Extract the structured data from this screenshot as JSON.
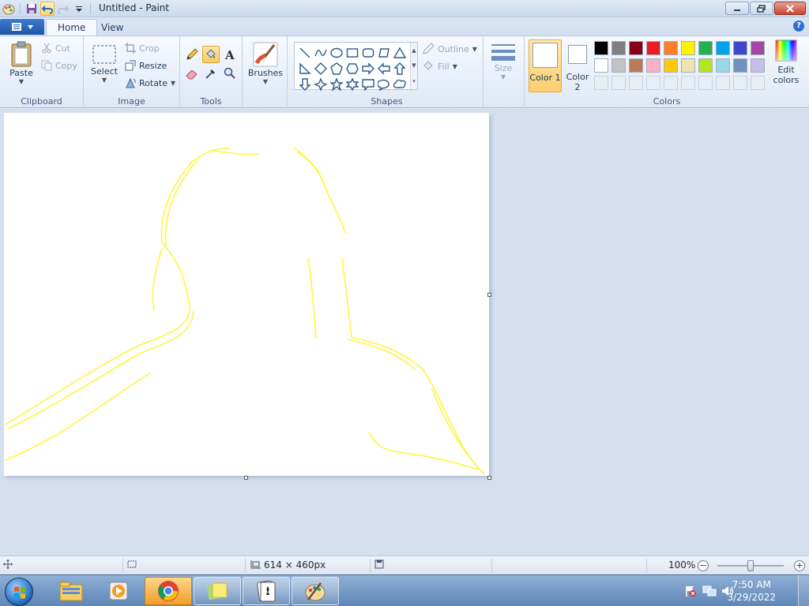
{
  "window": {
    "title": "Untitled - Paint"
  },
  "tabs": [
    {
      "label": "Home",
      "active": true
    },
    {
      "label": "View",
      "active": false
    }
  ],
  "ribbon": {
    "clipboard": {
      "label": "Clipboard",
      "paste": "Paste",
      "cut": "Cut",
      "copy": "Copy"
    },
    "image": {
      "label": "Image",
      "select": "Select",
      "crop": "Crop",
      "resize": "Resize",
      "rotate": "Rotate"
    },
    "tools": {
      "label": "Tools"
    },
    "brushes": {
      "label": "Brushes"
    },
    "shapes": {
      "label": "Shapes",
      "outline": "Outline",
      "fill": "Fill"
    },
    "size": {
      "label": "Size"
    },
    "colors": {
      "label": "Colors",
      "color1": "Color 1",
      "color2": "Color 2",
      "edit": "Edit colors",
      "palette_row1": [
        "#000000",
        "#7f7f7f",
        "#880015",
        "#ed1c24",
        "#ff7f27",
        "#fff200",
        "#22b14c",
        "#00a2e8",
        "#3f48cc",
        "#a349a4"
      ],
      "palette_row2": [
        "#ffffff",
        "#c3c3c3",
        "#b97a57",
        "#ffaec9",
        "#ffc90e",
        "#efe4b0",
        "#b5e61d",
        "#99d9ea",
        "#7092be",
        "#c8bfe7"
      ]
    }
  },
  "status": {
    "dimensions": "614 × 460px",
    "zoom": "100%",
    "zoom_fraction": 0.5
  },
  "taskbar": {
    "time": "7:50 AM",
    "date": "3/29/2022",
    "apps": [
      "explorer-icon",
      "media-player-icon",
      "chrome-icon",
      "sticky-notes-icon",
      "solitaire-icon",
      "paint-icon"
    ]
  },
  "accent": "#fbd06e",
  "stroke_color": "#fff200"
}
